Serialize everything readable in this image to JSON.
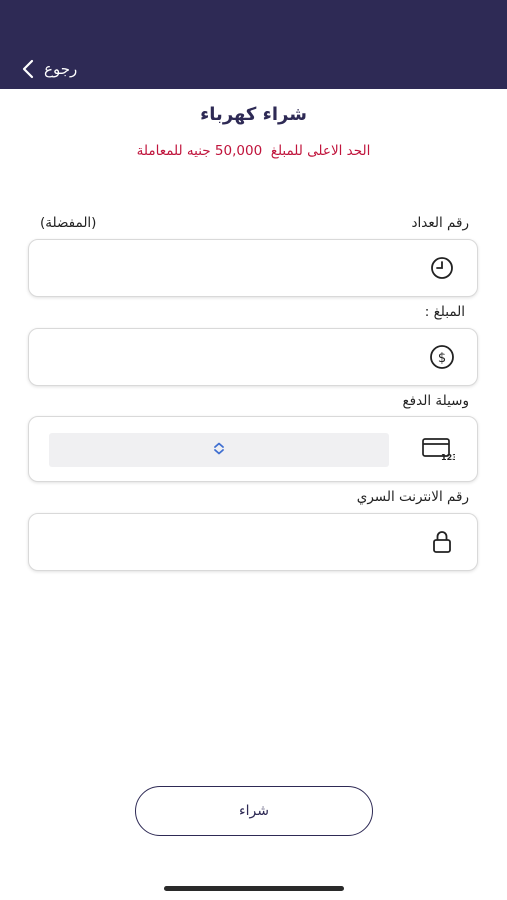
{
  "header": {
    "back_label": "رجوع"
  },
  "page": {
    "title": "شراء كهرباء",
    "limit_text": "الحد الاعلى للمبلغ  50,000 جنيه للمعاملة"
  },
  "form": {
    "meter": {
      "label": "رقم العداد",
      "favorites_label": "(المفضلة)",
      "value": ""
    },
    "amount": {
      "label": "المبلغ :",
      "value": ""
    },
    "payment": {
      "label": "وسيلة الدفع",
      "selected": ""
    },
    "pin": {
      "label": "رقم الانترنت السري",
      "value": ""
    }
  },
  "actions": {
    "buy_label": "شراء"
  },
  "colors": {
    "header_bg": "#2e2a55",
    "title": "#2e2a55",
    "limit": "#c0143c"
  }
}
